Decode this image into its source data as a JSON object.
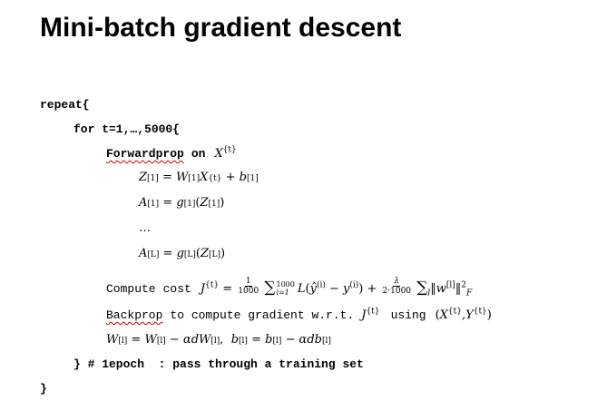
{
  "title": "Mini-batch gradient descent",
  "code": {
    "repeat": "repeat{",
    "for_loop": "for t=1,…,5000{",
    "forwardprop_word": "Forwardprop",
    "forwardprop_on": "on",
    "ellipsis": "…",
    "compute_word": "Compute",
    "cost_word": "cost",
    "backprop_word": "Backprop",
    "backprop_rest": "to compute gradient w.r.t.",
    "using_word": "using",
    "epoch_close": "} # 1epoch  : pass through a training set",
    "final_close": "}"
  },
  "math": {
    "X_t": "X",
    "t_sup": "{t}",
    "eq_z": "Z",
    "eq_a": "A",
    "eq_g": "g",
    "one_sup": "[1]",
    "L_sup": "[L]",
    "J": "J",
    "frac1_num": "1",
    "frac1_den": "1000",
    "sum_top": "1000",
    "sum_bot": "i=1",
    "lambda_num": "λ",
    "lambda_den": "2·1000",
    "F_sub": "F",
    "l_sup": "[l]",
    "i_sup": "(i)"
  }
}
